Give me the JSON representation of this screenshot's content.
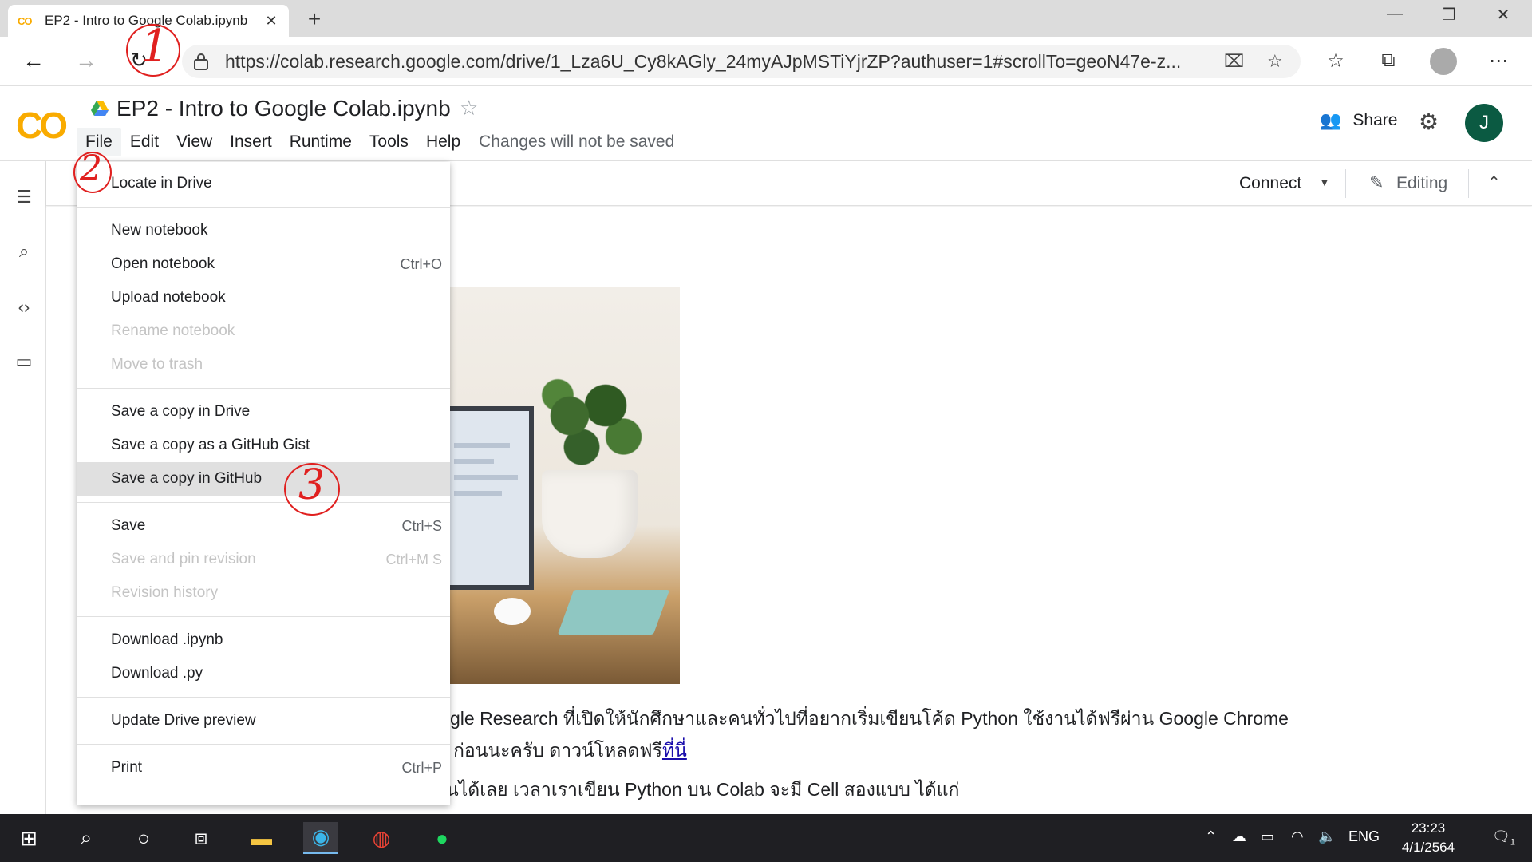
{
  "browser": {
    "tab_title": "EP2 - Intro to Google Colab.ipynb",
    "tab_favicon": "CO",
    "url": "https://colab.research.google.com/drive/1_Lza6U_Cy8kAGly_24myAJpMSTiYjrZP?authuser=1#scrollTo=geoN47e-z..."
  },
  "colab": {
    "logo": "CO",
    "notebook_title": "EP2 - Intro to Google Colab.ipynb",
    "menu": [
      "File",
      "Edit",
      "View",
      "Insert",
      "Runtime",
      "Tools",
      "Help"
    ],
    "menu_note": "Changes will not be saved",
    "share_label": "Share",
    "avatar_letter": "J",
    "connect_label": "Connect",
    "editing_label": "Editing"
  },
  "file_menu": {
    "locate": "Locate in Drive",
    "new_notebook": "New notebook",
    "open_notebook": "Open notebook",
    "open_shortcut": "Ctrl+O",
    "upload_notebook": "Upload notebook",
    "rename_notebook": "Rename notebook",
    "move_to_trash": "Move to trash",
    "save_copy_drive": "Save a copy in Drive",
    "save_copy_gist": "Save a copy as a GitHub Gist",
    "save_copy_github": "Save a copy in GitHub",
    "save": "Save",
    "save_shortcut": "Ctrl+S",
    "save_pin": "Save and pin revision",
    "save_pin_shortcut": "Ctrl+M S",
    "revision_history": "Revision history",
    "download_ipynb": "Download .ipynb",
    "download_py": "Download .py",
    "update_preview": "Update Drive preview",
    "print": "Print",
    "print_shortcut": "Ctrl+P"
  },
  "content": {
    "line1": "gle Research ที่เปิดให้นักศึกษาและคนทั่วไปที่อยากเริ่มเขียนโค้ด Python ใช้งานได้ฟรีผ่าน Google Chrome",
    "line2_prefix": "ก่อนนะครับ ดาวน์โหลดฟรี",
    "line2_link": "ที่นี่",
    "line3": "นได้เลย เวลาเราเขียน Python บน Colab จะมี Cell สองแบบ ได้แก่"
  },
  "annotations": {
    "mark1": "1",
    "mark2": "2",
    "mark3": "3"
  },
  "taskbar": {
    "language": "ENG",
    "time": "23:23",
    "date": "4/1/2564",
    "notification_count": "1"
  },
  "colors": {
    "colab_orange": "#f9ab00",
    "avatar_green": "#0b5a42",
    "annotation_red": "#e0201f",
    "hover_gray": "#e0e0e0"
  }
}
